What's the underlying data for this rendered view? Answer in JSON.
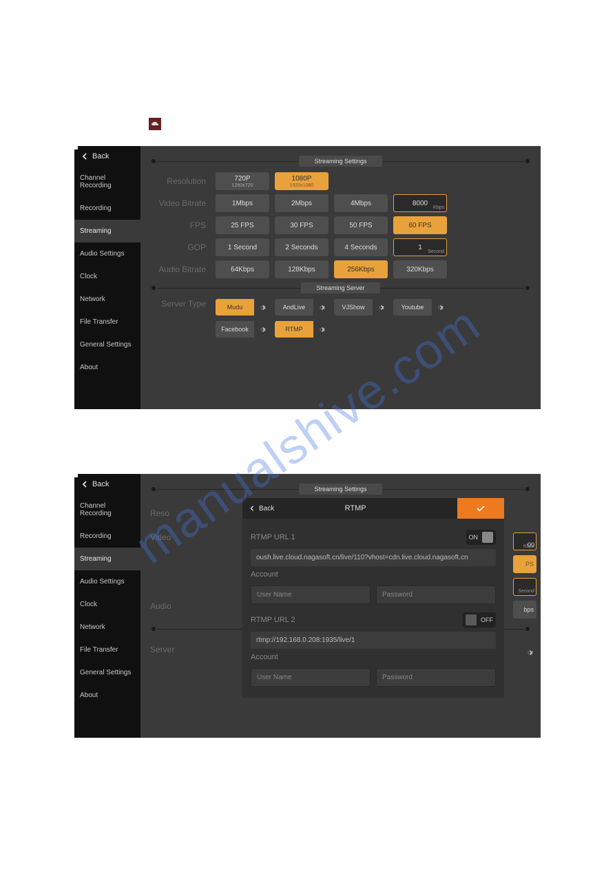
{
  "watermark": "manualshive.com",
  "sidebar": {
    "back": "Back",
    "items": [
      "Channel Recording",
      "Recording",
      "Streaming",
      "Audio Settings",
      "Clock",
      "Network",
      "File Transfer",
      "General Settings",
      "About"
    ],
    "active_index": 2
  },
  "section_titles": {
    "streaming_settings": "Streaming Settings",
    "streaming_server": "Streaming Server"
  },
  "settings": {
    "resolution": {
      "label": "Resolution",
      "opts": [
        {
          "l": "720P",
          "s": "1280x720"
        },
        {
          "l": "1080P",
          "s": "1920x1080"
        }
      ],
      "selected": 1
    },
    "video_bitrate": {
      "label": "Video Bitrate",
      "opts": [
        "1Mbps",
        "2Mbps",
        "4Mbps"
      ],
      "custom": "8000",
      "unit": "Kbps"
    },
    "fps": {
      "label": "FPS",
      "opts": [
        "25 FPS",
        "30 FPS",
        "50 FPS",
        "60 FPS"
      ],
      "selected": 3
    },
    "gop": {
      "label": "GOP",
      "opts": [
        "1 Second",
        "2 Seconds",
        "4 Seconds"
      ],
      "custom": "1",
      "unit": "Second"
    },
    "audio_bitrate": {
      "label": "Audio Bitrate",
      "opts": [
        "64Kbps",
        "128Kbps",
        "256Kbps",
        "320Kbps"
      ],
      "selected": 2
    },
    "server_type": {
      "label": "Server Type",
      "servers": [
        "Mudu",
        "AndLive",
        "VJShow",
        "Youtube",
        "Facebook",
        "RTMP"
      ],
      "selected": [
        0,
        5
      ]
    }
  },
  "rtmp_modal": {
    "title": "RTMP",
    "back": "Back",
    "url1_label": "RTMP URL 1",
    "url1_on": "ON",
    "url1_value": "oush.live.cloud.nagasoft.cn/live/110?vhost=cdn.live.cloud.nagasoft.cn",
    "account_label": "Account",
    "username_ph": "User Name",
    "password_ph": "Password",
    "url2_label": "RTMP URL 2",
    "url2_off": "OFF",
    "url2_value": "rtmp://192.168.0.208:1935/live/1"
  },
  "peek": {
    "digits": "00",
    "fps": "PS",
    "sec": "Second",
    "bps": "bps"
  }
}
